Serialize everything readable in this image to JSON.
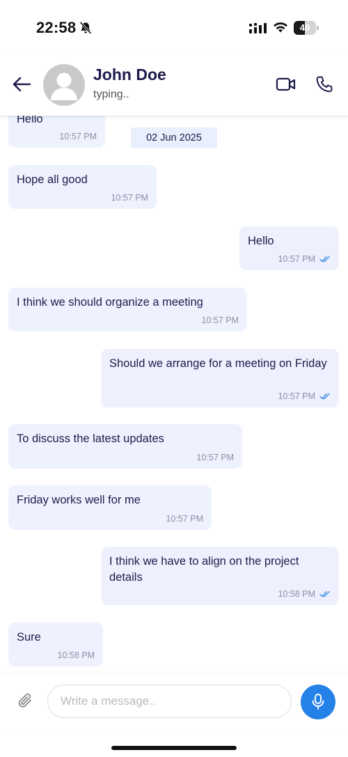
{
  "status_bar": {
    "time": "22:58",
    "battery_level": "49",
    "battery_fraction": 0.49
  },
  "header": {
    "contact_name": "John Doe",
    "contact_status": "typing.."
  },
  "date_separator": "02 Jun 2025",
  "messages": [
    {
      "direction": "in",
      "text": "Hello",
      "time": "10:57 PM"
    },
    {
      "direction": "in",
      "text": "Hope all good",
      "time": "10:57 PM"
    },
    {
      "direction": "out",
      "text": "Hello",
      "time": "10:57 PM",
      "read": true
    },
    {
      "direction": "in",
      "text": "I think we should organize a meeting",
      "time": "10:57 PM"
    },
    {
      "direction": "out",
      "text": "Should we arrange for a meeting on Friday",
      "time": "10:57 PM",
      "read": true
    },
    {
      "direction": "in",
      "text": "To discuss the latest updates",
      "time": "10:57 PM"
    },
    {
      "direction": "in",
      "text": "Friday works well for me",
      "time": "10:57 PM"
    },
    {
      "direction": "out",
      "text": "I think we have to align on the project details",
      "time": "10:58 PM",
      "read": true
    },
    {
      "direction": "in",
      "text": "Sure",
      "time": "10:58 PM"
    }
  ],
  "composer": {
    "placeholder": "Write a message..",
    "value": ""
  },
  "icons": {
    "back": "arrow-left-icon",
    "video": "video-camera-icon",
    "call": "phone-icon",
    "attach": "paperclip-icon",
    "mic": "microphone-icon",
    "read_receipt": "double-check-icon"
  },
  "colors": {
    "accent": "#2481e8",
    "bubble": "#eef2fe",
    "text": "#1e1b4b",
    "meta": "#8c8fa3",
    "read_tick": "#3b8de0"
  }
}
